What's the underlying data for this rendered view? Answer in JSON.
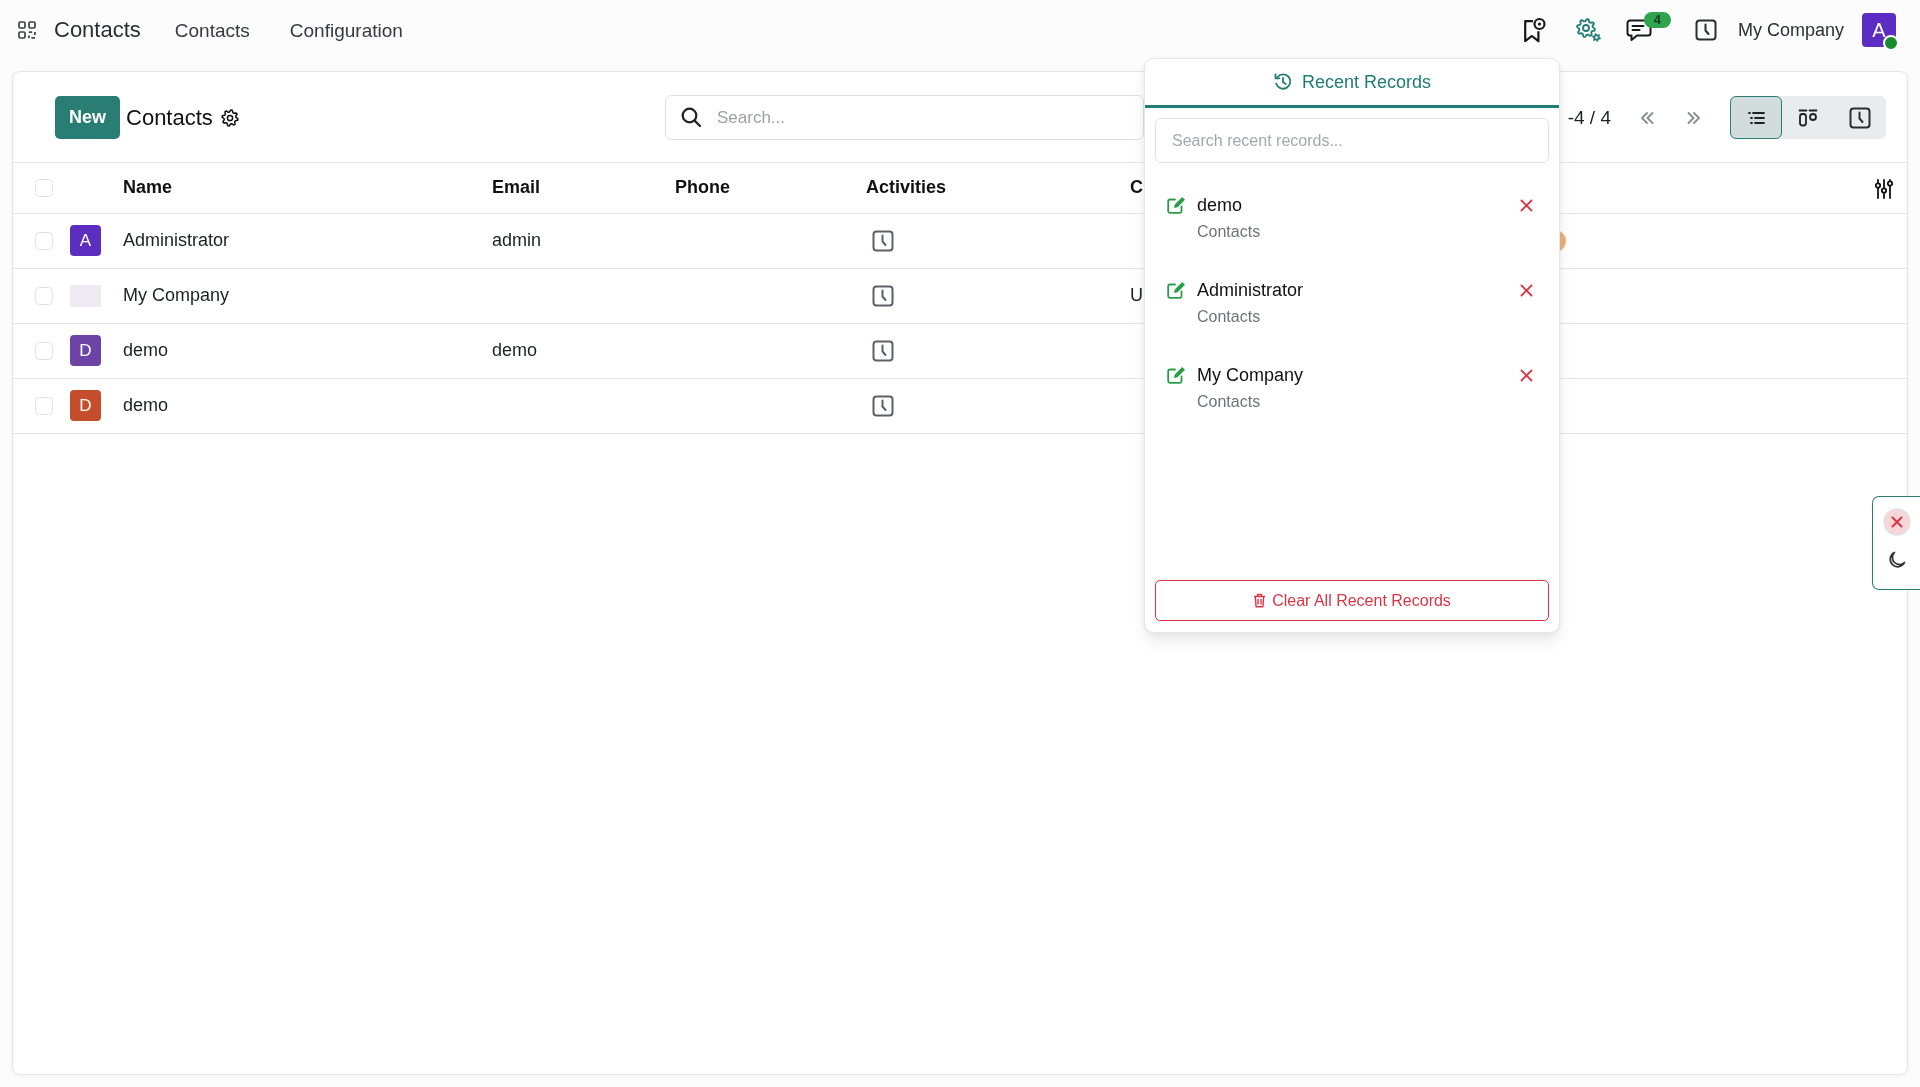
{
  "navbar": {
    "app_name": "Contacts",
    "menu": [
      {
        "label": "Contacts"
      },
      {
        "label": "Configuration"
      }
    ],
    "messages_badge": "4",
    "company": "My Company",
    "user": {
      "initial": "A",
      "online": true
    }
  },
  "control_panel": {
    "new_button": "New",
    "title": "Contacts",
    "search": {
      "placeholder": "Search..."
    },
    "pager": "-4 / 4",
    "views": [
      {
        "kind": "list",
        "selected": true
      },
      {
        "kind": "kanban",
        "selected": false
      },
      {
        "kind": "activity",
        "selected": false
      }
    ]
  },
  "table": {
    "select_all": {
      "checked": false
    },
    "columns": [
      {
        "label": "Name"
      },
      {
        "label": "Email"
      },
      {
        "label": "Phone"
      },
      {
        "label": "Activities"
      },
      {
        "label": "C"
      }
    ],
    "rows": [
      {
        "checked": false,
        "avatar": {
          "kind": "initial",
          "initial": "A",
          "color": "#5b2ec0"
        },
        "name": "Administrator",
        "email": "admin",
        "column_6_marker": true
      },
      {
        "checked": false,
        "avatar": {
          "kind": "image"
        },
        "name": "My Company",
        "column_5": "U",
        "column_6_marker": false
      },
      {
        "checked": false,
        "avatar": {
          "kind": "initial",
          "initial": "D",
          "color": "#6c44a6"
        },
        "name": "demo",
        "email": "demo",
        "column_6_marker": false
      },
      {
        "checked": false,
        "avatar": {
          "kind": "initial",
          "initial": "D",
          "color": "#c44d2b"
        },
        "name": "demo",
        "column_6_marker": false
      }
    ]
  },
  "recent_records": {
    "title": "Recent Records",
    "search": {
      "placeholder": "Search recent records..."
    },
    "items": [
      {
        "name": "demo",
        "model": "Contacts"
      },
      {
        "name": "Administrator",
        "model": "Contacts"
      },
      {
        "name": "My Company",
        "model": "Contacts"
      }
    ],
    "clear_button": "Clear All Recent Records"
  }
}
